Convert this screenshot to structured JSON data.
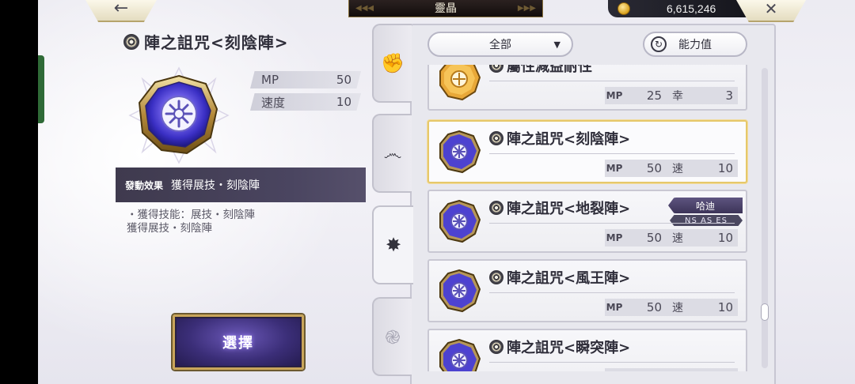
{
  "header": {
    "back_icon": "arrow-left",
    "title": "靈晶",
    "currency_icon": "gold-coin",
    "currency_amount": "6,615,246",
    "close_icon": "close-x"
  },
  "detail": {
    "name": "陣之詛咒<刻陰陣>",
    "stats": [
      {
        "label": "MP",
        "value": "50"
      },
      {
        "label": "速度",
        "value": "10"
      }
    ],
    "effect_label": "發動效果",
    "effect_value": "獲得展技・刻陰陣",
    "description_line1": "・獲得技能：展技・刻陰陣",
    "description_line2": "獲得展技・刻陰陣",
    "select_label": "選擇"
  },
  "tabs": [
    {
      "icon": "fist-icon"
    },
    {
      "icon": "wind-swirl-icon"
    },
    {
      "icon": "rune-star-icon",
      "active": true
    },
    {
      "icon": "spiral-icon"
    }
  ],
  "toolbar": {
    "filter_value": "全部",
    "stat_button_label": "能力值"
  },
  "list": [
    {
      "name": "屬性減益耐性",
      "stat1_key": "MP",
      "stat1_val": "25",
      "stat2_key": "幸",
      "stat2_val": "3",
      "gem_color": "amber"
    },
    {
      "name": "陣之詛咒<刻陰陣>",
      "stat1_key": "MP",
      "stat1_val": "50",
      "stat2_key": "速",
      "stat2_val": "10",
      "gem_color": "blue",
      "selected": true
    },
    {
      "name": "陣之詛咒<地裂陣>",
      "stat1_key": "MP",
      "stat1_val": "50",
      "stat2_key": "速",
      "stat2_val": "10",
      "gem_color": "blue",
      "owner": "哈迪",
      "owner_tag": "NS  AS  ES"
    },
    {
      "name": "陣之詛咒<風王陣>",
      "stat1_key": "MP",
      "stat1_val": "50",
      "stat2_key": "速",
      "stat2_val": "10",
      "gem_color": "blue"
    },
    {
      "name": "陣之詛咒<瞬突陣>",
      "stat1_key": "MP",
      "stat1_val": "50",
      "stat2_key": "速",
      "stat2_val": "10",
      "gem_color": "blue"
    }
  ]
}
